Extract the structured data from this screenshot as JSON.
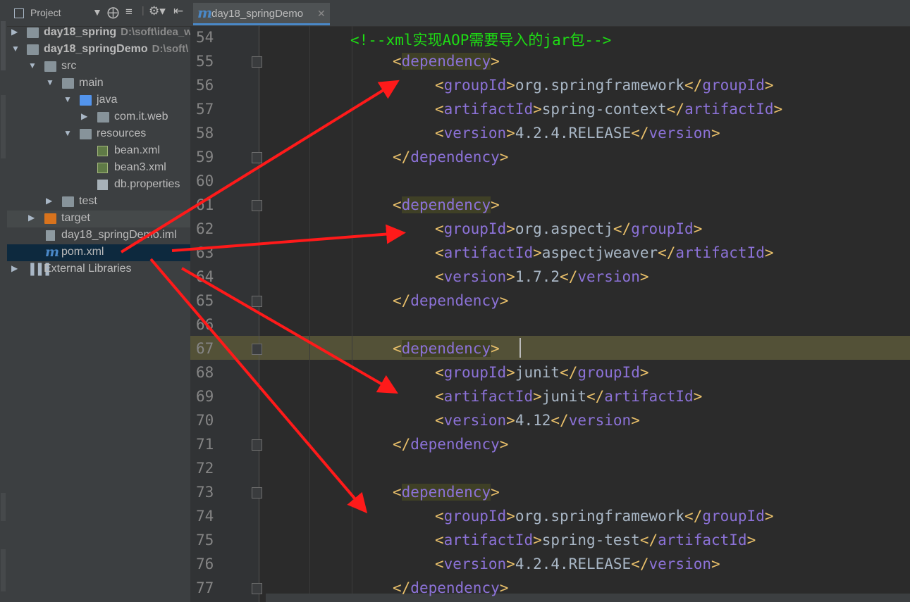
{
  "project_panel": {
    "title": "Project",
    "tree": [
      {
        "label": "day18_spring",
        "path": "D:\\soft\\idea_w",
        "type": "module",
        "expanded": false,
        "bold": true
      },
      {
        "label": "day18_springDemo",
        "path": "D:\\soft\\",
        "type": "module",
        "expanded": true,
        "bold": true
      },
      {
        "label": "src",
        "type": "folder",
        "expanded": true
      },
      {
        "label": "main",
        "type": "folder",
        "expanded": true
      },
      {
        "label": "java",
        "type": "folder-source",
        "expanded": true
      },
      {
        "label": "com.it.web",
        "type": "package",
        "expanded": false
      },
      {
        "label": "resources",
        "type": "folder-resources",
        "expanded": true
      },
      {
        "label": "bean.xml",
        "type": "xml-file"
      },
      {
        "label": "bean3.xml",
        "type": "xml-file"
      },
      {
        "label": "db.properties",
        "type": "properties-file"
      },
      {
        "label": "test",
        "type": "folder",
        "expanded": false
      },
      {
        "label": "target",
        "type": "folder-excluded",
        "expanded": false
      },
      {
        "label": "day18_springDemo.iml",
        "type": "iml-file"
      },
      {
        "label": "pom.xml",
        "type": "maven-file",
        "selected": true
      },
      {
        "label": "External Libraries",
        "type": "libraries",
        "expanded": false
      }
    ]
  },
  "editor": {
    "tab_label": "day18_springDemo",
    "tab_icon": "m",
    "current_line": "67",
    "lines": [
      {
        "num": "54",
        "text": "<!--xml实现AOP需要导入的jar包-->"
      },
      {
        "num": "55",
        "text": "<dependency>"
      },
      {
        "num": "56",
        "text": "<groupId>org.springframework</groupId>"
      },
      {
        "num": "57",
        "text": "<artifactId>spring-context</artifactId>"
      },
      {
        "num": "58",
        "text": "<version>4.2.4.RELEASE</version>"
      },
      {
        "num": "59",
        "text": "</dependency>"
      },
      {
        "num": "60",
        "text": ""
      },
      {
        "num": "61",
        "text": "<dependency>"
      },
      {
        "num": "62",
        "text": "<groupId>org.aspectj</groupId>"
      },
      {
        "num": "63",
        "text": "<artifactId>aspectjweaver</artifactId>"
      },
      {
        "num": "64",
        "text": "<version>1.7.2</version>"
      },
      {
        "num": "65",
        "text": "</dependency>"
      },
      {
        "num": "66",
        "text": ""
      },
      {
        "num": "67",
        "text": "<dependency>"
      },
      {
        "num": "68",
        "text": "<groupId>junit</groupId>"
      },
      {
        "num": "69",
        "text": "<artifactId>junit</artifactId>"
      },
      {
        "num": "70",
        "text": "<version>4.12</version>"
      },
      {
        "num": "71",
        "text": "</dependency>"
      },
      {
        "num": "72",
        "text": ""
      },
      {
        "num": "73",
        "text": "<dependency>"
      },
      {
        "num": "74",
        "text": "<groupId>org.springframework</groupId>"
      },
      {
        "num": "75",
        "text": "<artifactId>spring-test</artifactId>"
      },
      {
        "num": "76",
        "text": "<version>4.2.4.RELEASE</version>"
      },
      {
        "num": "77",
        "text": "</dependency>"
      }
    ]
  },
  "colors": {
    "bracket": "#e8bf6a",
    "tag_name": "#8c72d8",
    "text": "#a9b7c6",
    "comment": "#1edc14",
    "annotation_arrow": "#ff1a1a",
    "selection": "#0d293e",
    "current_line": "#535137"
  }
}
